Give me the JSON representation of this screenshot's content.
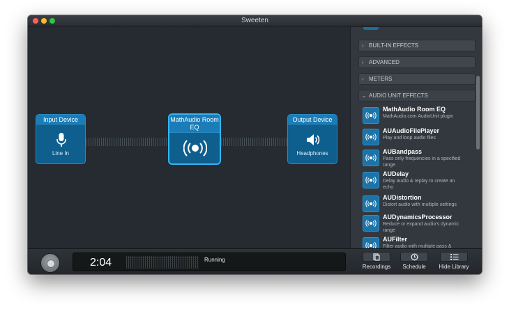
{
  "window": {
    "title": "Sweeten"
  },
  "chain": {
    "input": {
      "title": "Input Device",
      "label": "Line In"
    },
    "effect": {
      "title": "MathAudio Room EQ"
    },
    "output": {
      "title": "Output Device",
      "label": "Headphones"
    }
  },
  "library": {
    "sections": [
      {
        "label": "BUILT-IN EFFECTS",
        "expanded": false
      },
      {
        "label": "ADVANCED",
        "expanded": false
      },
      {
        "label": "METERS",
        "expanded": false
      },
      {
        "label": "AUDIO UNIT EFFECTS",
        "expanded": true
      }
    ],
    "effects": [
      {
        "name": "MathAudio Room EQ",
        "desc": "MathAudio.com AudioUnit plugin"
      },
      {
        "name": "AUAudioFilePlayer",
        "desc": "Play and loop audio files"
      },
      {
        "name": "AUBandpass",
        "desc": "Pass only frequencies in a specified range"
      },
      {
        "name": "AUDelay",
        "desc": "Delay audio & replay to create an echo"
      },
      {
        "name": "AUDistortion",
        "desc": "Distort audio with multiple settings"
      },
      {
        "name": "AUDynamicsProcessor",
        "desc": "Reduce or expand audio's dynamic range"
      },
      {
        "name": "AUFilter",
        "desc": "Filter audio with multiple pass &"
      }
    ]
  },
  "transport": {
    "time": "2:04",
    "status": "Running",
    "recordings_label": "Recordings",
    "schedule_label": "Schedule",
    "hide_library_label": "Hide Library"
  },
  "colors": {
    "node_fill": "#0f5f8e",
    "node_accent": "#35b4f0",
    "background": "#262b32"
  }
}
